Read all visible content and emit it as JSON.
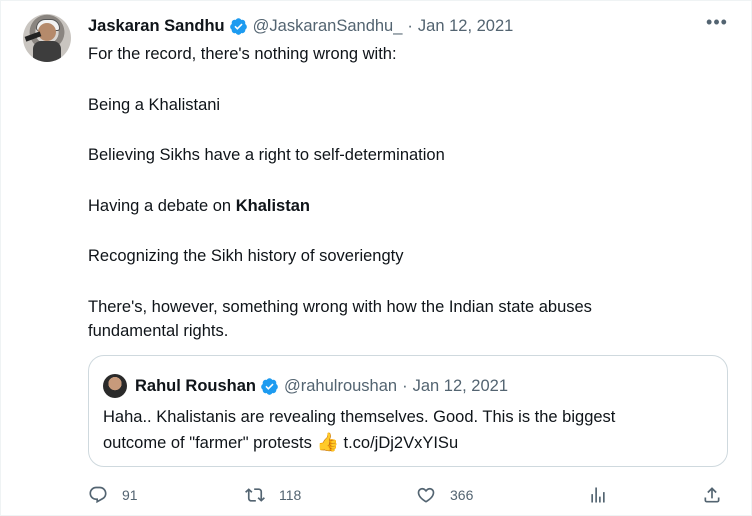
{
  "tweet": {
    "author_name": "Jaskaran Sandhu",
    "author_handle": "@JaskaranSandhu_",
    "separator": "·",
    "date": "Jan 12, 2021",
    "more_label": "•••",
    "lines": {
      "l1": "For the record, there's nothing wrong with:",
      "l2": "Being a Khalistani",
      "l3": "Believing Sikhs have a right to self-determination",
      "l4_prefix": "Having a debate on ",
      "l4_bold": "Khalistan",
      "l5": "Recognizing the Sikh history of soveriengty",
      "l6a": "There's, however, something wrong with how the Indian state abuses",
      "l6b": "fundamental rights."
    }
  },
  "quote": {
    "author_name": "Rahul Roushan",
    "author_handle": "@rahulroushan",
    "separator": "·",
    "date": "Jan 12, 2021",
    "line1": "Haha.. Khalistanis are revealing themselves. Good. This is the biggest",
    "line2": "outcome of \"farmer\" protests ",
    "emoji": "👍",
    "link": "t.co/jDj2VxYISu"
  },
  "actions": {
    "reply_count": "91",
    "retweet_count": "118",
    "like_count": "366"
  },
  "colors": {
    "verified": "#1d9bf0",
    "secondary_text": "#536471",
    "border": "#cfd9de"
  },
  "icons": [
    "verified-badge-icon",
    "more-icon",
    "reply-icon",
    "retweet-icon",
    "like-icon",
    "views-icon",
    "share-icon"
  ]
}
